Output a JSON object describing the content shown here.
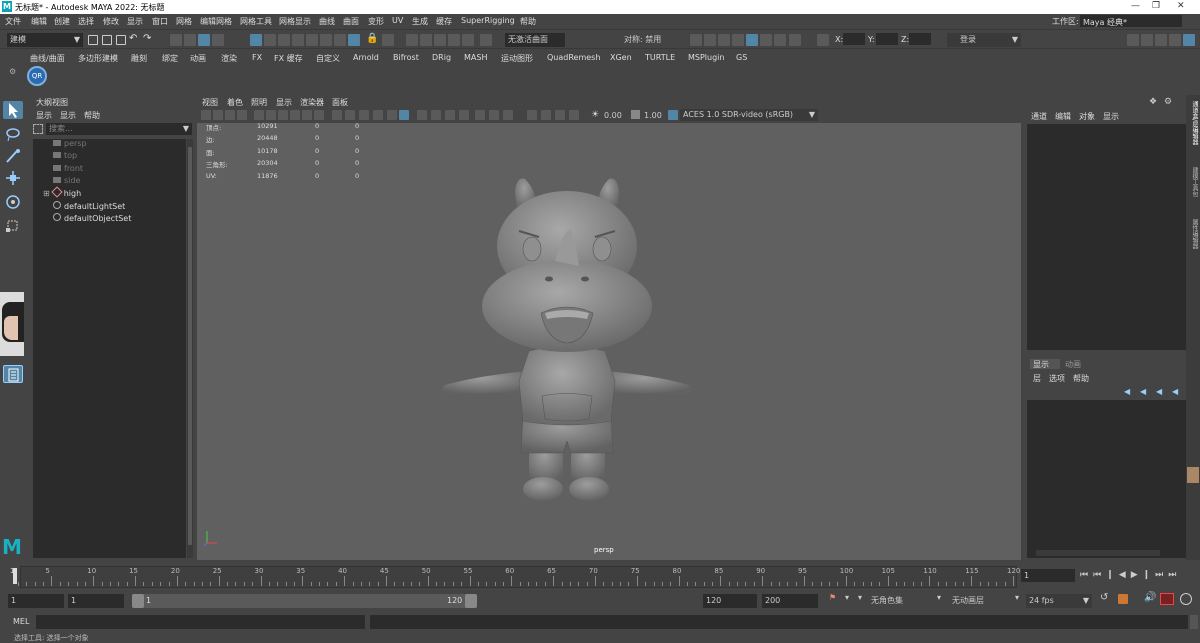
{
  "window": {
    "title": "无标题* - Autodesk MAYA 2022: 无标题",
    "logo": "M"
  },
  "menubar": {
    "items": [
      "文件",
      "编辑",
      "创建",
      "选择",
      "修改",
      "显示",
      "窗口",
      "网格",
      "编辑网格",
      "网格工具",
      "网格显示",
      "曲线",
      "曲面",
      "变形",
      "UV",
      "生成",
      "缓存",
      "SuperRigging",
      "帮助"
    ],
    "workspace_label": "工作区:",
    "workspace_value": "Maya 经典*"
  },
  "statusline": {
    "mode": "建模",
    "no_active_surface": "无激活曲面",
    "symmetry": "对称: 禁用",
    "x_label": "X:",
    "y_label": "Y:",
    "z_label": "Z:",
    "login": "登录"
  },
  "shelf_tabs": [
    "曲线/曲面",
    "多边形建模",
    "雕刻",
    "绑定",
    "动画",
    "渲染",
    "FX",
    "FX 缓存",
    "自定义",
    "Arnold",
    "Bifrost",
    "DRig",
    "MASH",
    "运动图形",
    "QuadRemesh",
    "XGen",
    "TURTLE",
    "MSPlugin",
    "GS"
  ],
  "shelf": {
    "qr_label": "QR"
  },
  "outliner": {
    "title": "大纲视图",
    "menu": [
      "显示",
      "显示",
      "帮助"
    ],
    "search_placeholder": "搜索...",
    "items": [
      {
        "label": "persp",
        "dim": true
      },
      {
        "label": "top",
        "dim": true
      },
      {
        "label": "front",
        "dim": true
      },
      {
        "label": "side",
        "dim": true
      },
      {
        "label": "high",
        "dim": false
      },
      {
        "label": "defaultLightSet",
        "dim": false
      },
      {
        "label": "defaultObjectSet",
        "dim": false
      }
    ]
  },
  "viewport": {
    "menu": [
      "视图",
      "着色",
      "照明",
      "显示",
      "渲染器",
      "面板"
    ],
    "exposure": "0.00",
    "gamma": "1.00",
    "color_space": "ACES 1.0 SDR-video (sRGB)",
    "camera_label": "persp",
    "hud": [
      {
        "label": "顶点:",
        "v1": "10291",
        "v2": "0",
        "v3": "0"
      },
      {
        "label": "边:",
        "v1": "20448",
        "v2": "0",
        "v3": "0"
      },
      {
        "label": "面:",
        "v1": "10178",
        "v2": "0",
        "v3": "0"
      },
      {
        "label": "三角形:",
        "v1": "20304",
        "v2": "0",
        "v3": "0"
      },
      {
        "label": "UV:",
        "v1": "11876",
        "v2": "0",
        "v3": "0"
      }
    ]
  },
  "channel_box": {
    "menu": [
      "通道",
      "编辑",
      "对象",
      "显示"
    ]
  },
  "layer_editor": {
    "tabs": [
      "显示",
      "动画"
    ],
    "menu": [
      "层",
      "选项",
      "帮助"
    ]
  },
  "side_tabs": [
    "通道盒/层编辑器",
    "建模工具包",
    "属性编辑器"
  ],
  "timeline": {
    "ticks": [
      "5",
      "10",
      "15",
      "20",
      "25",
      "30",
      "35",
      "40",
      "45",
      "50",
      "55",
      "60",
      "65",
      "70",
      "75",
      "80",
      "85",
      "90",
      "95",
      "100",
      "105",
      "110",
      "115",
      "120"
    ],
    "first_tick": "1",
    "current_frame": "1"
  },
  "range": {
    "start": "1",
    "start2": "1",
    "slider_start": "1",
    "slider_end": "120",
    "end": "120",
    "end2": "200",
    "character_set": "无角色集",
    "anim_layer": "无动画层",
    "fps": "24 fps"
  },
  "cmd": {
    "label": "MEL"
  },
  "help": {
    "text": "选择工具: 选择一个对象"
  },
  "colors": {
    "accent": "#5285a6",
    "panel": "#444444",
    "field": "#2b2b2b",
    "viewport": "#606060",
    "maya_logo": "#0ba4b4"
  }
}
